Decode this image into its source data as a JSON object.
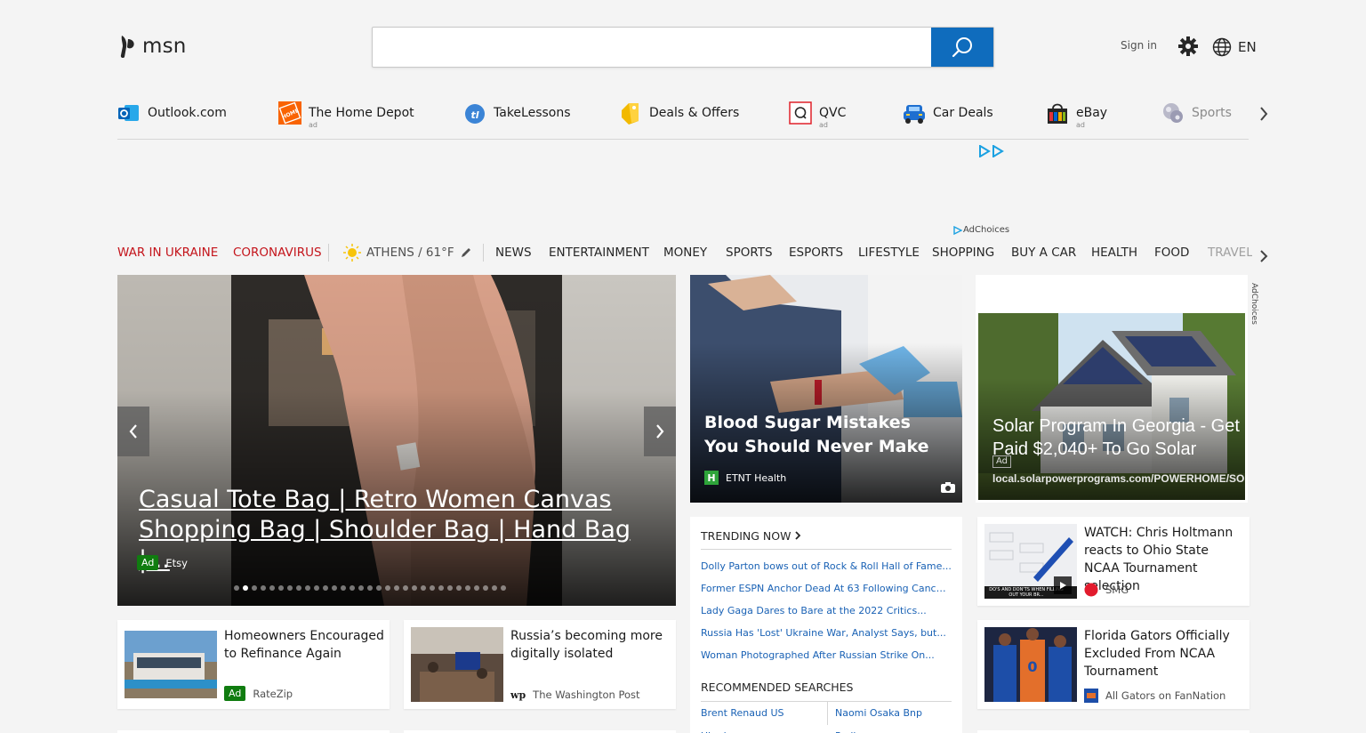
{
  "header": {
    "logo_text": "msn",
    "search_placeholder": "",
    "sign_in": "Sign in",
    "language": "EN"
  },
  "quicklinks": [
    {
      "label": "Outlook.com",
      "ad": "",
      "icon": "outlook-icon"
    },
    {
      "label": "The Home Depot",
      "ad": "ad",
      "icon": "home-depot-icon"
    },
    {
      "label": "TakeLessons",
      "ad": "",
      "icon": "takelessons-icon"
    },
    {
      "label": "Deals & Offers",
      "ad": "",
      "icon": "deals-tag-icon"
    },
    {
      "label": "QVC",
      "ad": "ad",
      "icon": "qvc-icon"
    },
    {
      "label": "Car Deals",
      "ad": "",
      "icon": "car-icon"
    },
    {
      "label": "eBay",
      "ad": "ad",
      "icon": "ebay-bag-icon"
    },
    {
      "label": "Sports",
      "ad": "",
      "icon": "sports-ball-icon"
    }
  ],
  "ad_choices": "AdChoices",
  "nav": {
    "highlights": [
      "WAR IN UKRAINE",
      "CORONAVIRUS"
    ],
    "weather": "ATHENS / 61°F",
    "categories": [
      "NEWS",
      "ENTERTAINMENT",
      "MONEY",
      "SPORTS",
      "ESPORTS",
      "LIFESTYLE",
      "SHOPPING",
      "BUY A CAR",
      "HEALTH",
      "FOOD",
      "TRAVEL"
    ]
  },
  "hero": {
    "title": "Casual Tote Bag | Retro Women Canvas Shopping Bag | Shoulder Bag | Hand Bag |...",
    "ad_label": "Ad",
    "source": "Etsy",
    "slide_count": 31,
    "active_slide": 2
  },
  "feature": {
    "title": "Blood Sugar Mistakes You Should Never Make",
    "source_icon_letter": "H",
    "source": "ETNT Health"
  },
  "solar_ad": {
    "title": "Solar Program In Georgia - Get Paid $2,040+ To Go Solar",
    "ad_label": "Ad",
    "url": "local.solarpowerprograms.com/POWERHOME/SO",
    "ad_choices": "AdChoices"
  },
  "trending": {
    "heading": "TRENDING NOW",
    "items": [
      "Dolly Parton bows out of Rock & Roll Hall of Fame...",
      "Former ESPN Anchor Dead At 63 Following Cancer...",
      "Lady Gaga Dares to Bare at the 2022 Critics...",
      "Russia Has 'Lost' Ukraine War, Analyst Says, but...",
      "Woman Photographed After Russian Strike On..."
    ]
  },
  "recommended": {
    "heading": "RECOMMENDED SEARCHES",
    "items": [
      "Brent Renaud US Ukraine",
      "Naomi Osaka Bnp Parib..."
    ]
  },
  "cards": [
    {
      "title": "Homeowners Encouraged to Refinance Again",
      "ad_label": "Ad",
      "source": "RateZip"
    },
    {
      "title": "Russia’s becoming more digitally isolated",
      "source_logo": "wp",
      "source": "The Washington Post"
    },
    {
      "title": "WATCH: Chris Holtmann reacts to Ohio State NCAA Tournament selection",
      "source": "SMG",
      "thumb_caption": "DO'S AND DON'TS WHEN FILLING OUT YOUR BR..."
    },
    {
      "title": "Florida Gators Officially Excluded From NCAA Tournament",
      "source": "All Gators on FanNation"
    }
  ],
  "colors": {
    "accent_blue": "#0f6cbd",
    "link_blue": "#1a62b5",
    "highlight_red": "#c4151c",
    "ad_green": "#107c10"
  }
}
